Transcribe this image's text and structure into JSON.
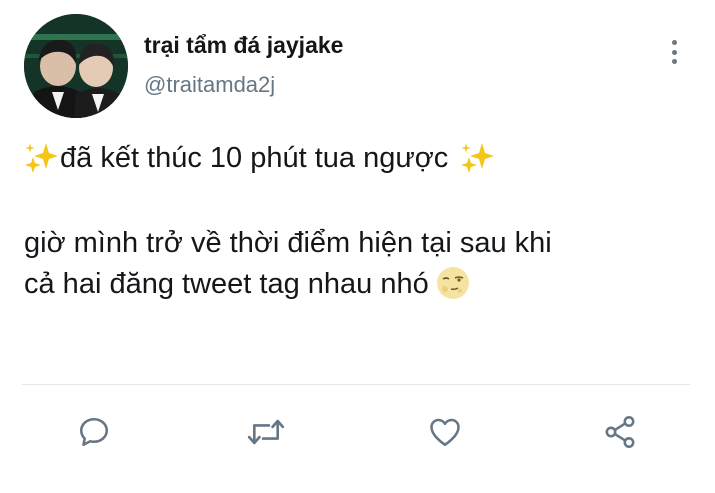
{
  "tweet": {
    "display_name": "trại tẩm đá jayjake",
    "handle": "@traitamda2j",
    "line1": "đã kết thúc 10 phút tua ngược",
    "line2": "giờ mình trở về thời điểm hiện tại sau khi",
    "line3": "cả hai đăng tweet tag nhau nhó"
  },
  "icons": {
    "more": "more-vertical-icon",
    "reply": "reply-icon",
    "retweet": "retweet-icon",
    "like": "heart-icon",
    "share": "share-icon",
    "emoji_sparkles": "sparkles-icon",
    "emoji_moon": "moon-face-icon"
  },
  "colors": {
    "text": "#14171a",
    "secondary": "#657786",
    "icon": "#657786",
    "sparkle": "#f5c518"
  }
}
